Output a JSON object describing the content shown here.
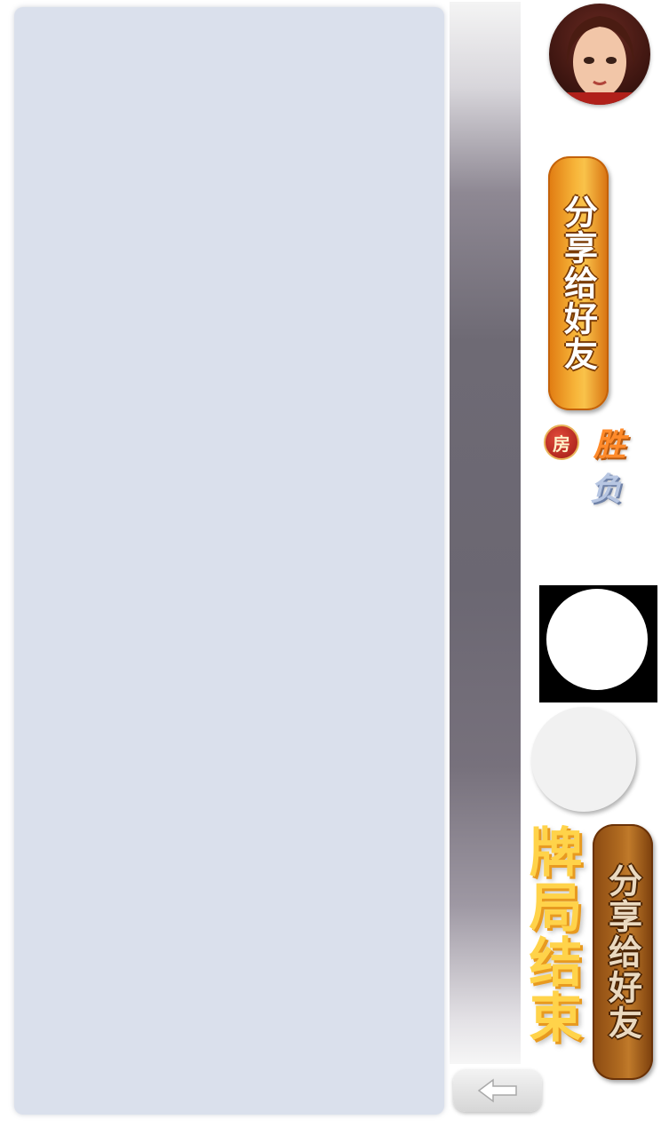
{
  "share_button_top": {
    "label": "分享给好友"
  },
  "share_button_bottom": {
    "label": "分享给好友"
  },
  "room_badge": {
    "label": "房"
  },
  "result": {
    "win": "胜",
    "lose": "负"
  },
  "game_over_title": "牌局结束",
  "colors": {
    "panel": "#dae0ec",
    "accent_orange": "#f7b53a",
    "accent_brown": "#b06a20",
    "title_yellow": "#ffd34a"
  }
}
